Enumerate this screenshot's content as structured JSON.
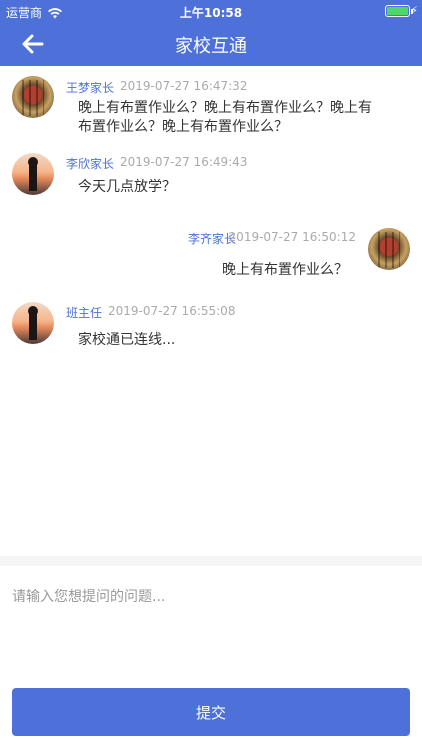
{
  "status": {
    "carrier": "运营商",
    "time": "上午10:58",
    "battery_level": 1.0
  },
  "nav": {
    "title": "家校互通",
    "back_icon": "arrow-left-icon"
  },
  "messages": [
    {
      "side": "left",
      "avatar": "painting",
      "name": "王梦家长",
      "time": "2019-07-27 16:47:32",
      "text": "晚上有布置作业么？晚上有布置作业么？晚上有布置作业么？晚上有布置作业么？"
    },
    {
      "side": "left",
      "avatar": "sunset",
      "name": "李欣家长",
      "time": "2019-07-27 16:49:43",
      "text": "今天几点放学？"
    },
    {
      "side": "right",
      "avatar": "painting",
      "name": "李齐家长",
      "time": "2019-07-27 16:50:12",
      "text": "晚上有布置作业么？"
    },
    {
      "side": "left",
      "avatar": "sunset",
      "name": "班主任",
      "time": "2019-07-27 16:55:08",
      "text": "家校通已连线..."
    }
  ],
  "input": {
    "placeholder": "请输入您想提问的问题..."
  },
  "submit_label": "提交",
  "colors": {
    "primary": "#4d71d9",
    "name": "#4d71d9",
    "timestamp": "#aaaaaa"
  }
}
